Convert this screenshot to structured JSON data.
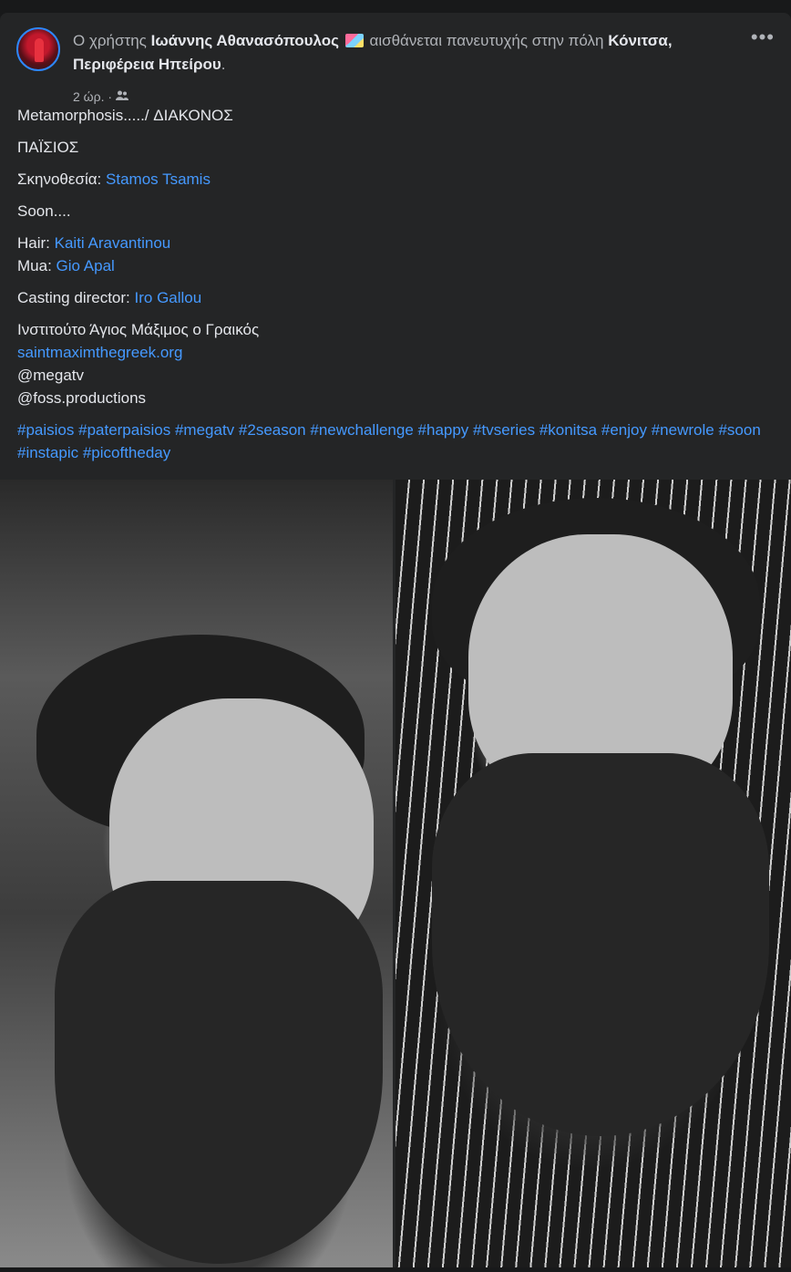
{
  "post": {
    "author_prefix": "Ο χρήστης",
    "author_name": "Ιωάννης Αθανασόπουλος",
    "feeling_text": "αισθάνεται πανευτυχής στην πόλη",
    "location": "Κόνιτσα, Περιφέρεια Ηπείρου",
    "location_suffix": ".",
    "timestamp": "2 ώρ.",
    "separator": "·",
    "audience_icon": "friends-icon",
    "more_icon": "more-options-icon",
    "more_label": "•••"
  },
  "content": {
    "line1": "Metamorphosis...../ ΔΙΑΚΟΝΟΣ",
    "line2": "ΠΑΪΣΙΟΣ",
    "direction_label": "Σκηνοθεσία:",
    "direction_name": "Stamos Tsamis",
    "soon": "Soon....",
    "hair_label": "Hair:",
    "hair_name": "Kaiti Aravantinou",
    "mua_label": "Mua:",
    "mua_name": "Gio Apal",
    "casting_label": "Casting director:",
    "casting_name": "Iro Gallou",
    "institute": "Ινστιτούτο Άγιος Μάξιμος ο Γραικός",
    "website": "saintmaximthegreek.org",
    "mention1": "@megatv",
    "mention2": "@foss.productions",
    "hashtags": [
      "#paisios",
      "#paterpaisios",
      "#megatv",
      "#2season",
      "#newchallenge",
      "#happy",
      "#tvseries",
      "#konitsa",
      "#enjoy",
      "#newrole",
      "#soon",
      "#instapic",
      "#picoftheday"
    ]
  },
  "colors": {
    "background": "#18191a",
    "card": "#242526",
    "text_primary": "#e4e6eb",
    "text_secondary": "#b0b3b8",
    "link": "#4599ff"
  }
}
